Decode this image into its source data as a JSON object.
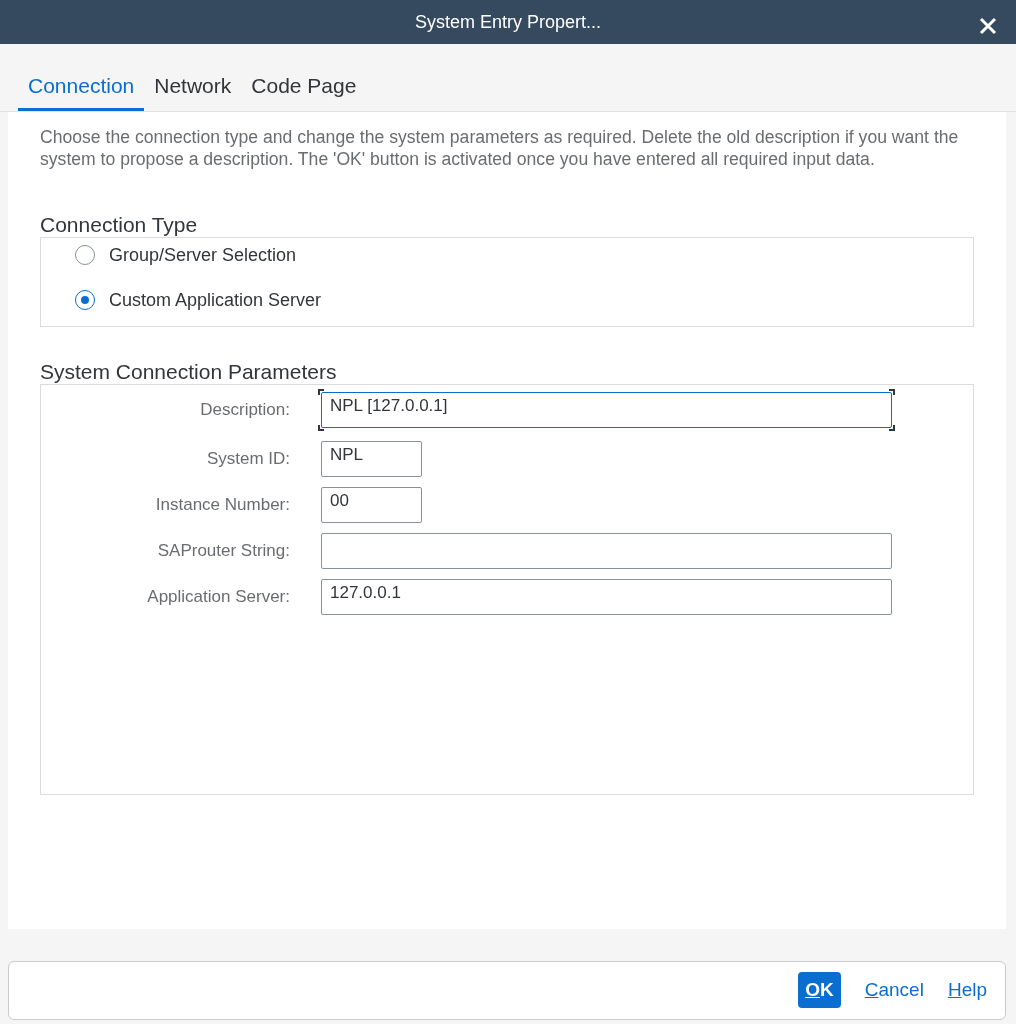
{
  "window": {
    "title": "System Entry Propert..."
  },
  "tabs": [
    {
      "label": "Connection",
      "selected": true
    },
    {
      "label": "Network",
      "selected": false
    },
    {
      "label": "Code Page",
      "selected": false
    }
  ],
  "intro": "Choose the connection type and change the system parameters as required. Delete the old description if you want the system to propose a description. The 'OK' button is activated once you have entered all required input data.",
  "connection_type": {
    "title": "Connection Type",
    "options": [
      {
        "label": "Group/Server Selection",
        "selected": false
      },
      {
        "label": "Custom Application Server",
        "selected": true
      }
    ]
  },
  "parameters": {
    "title": "System Connection Parameters",
    "fields": [
      {
        "label": "Description:",
        "value": "NPL [127.0.0.1]",
        "kind": "wide",
        "focused": true
      },
      {
        "label": "System ID:",
        "value": "NPL",
        "kind": "short",
        "focused": false
      },
      {
        "label": "Instance Number:",
        "value": "00",
        "kind": "short",
        "focused": false
      },
      {
        "label": "SAProuter String:",
        "kind": "wide",
        "focused": false
      },
      {
        "label": "Application Server:",
        "value": "127.0.0.1",
        "kind": "wide",
        "focused": false
      }
    ]
  },
  "buttons": [
    {
      "label": "OK",
      "kind": "primary"
    },
    {
      "label": "Cancel",
      "kind": "link"
    },
    {
      "label": "Help",
      "kind": "link"
    }
  ]
}
